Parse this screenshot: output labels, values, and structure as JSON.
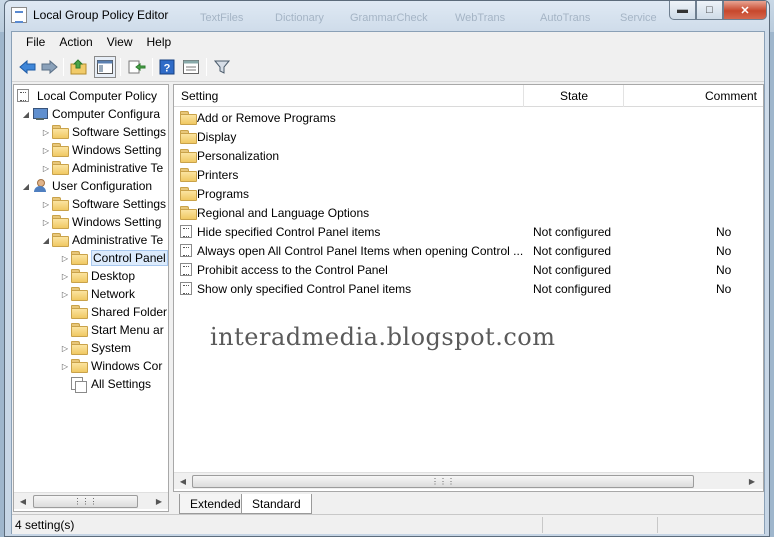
{
  "window": {
    "title": "Local Group Policy Editor",
    "background_taskbar_items": [
      "TextFiles",
      "Dictionary",
      "GrammarCheck",
      "WebTrans",
      "AutoTrans",
      "Service"
    ]
  },
  "menu": [
    "File",
    "Action",
    "View",
    "Help"
  ],
  "toolbar": {
    "icons": [
      "back-arrow-icon",
      "forward-arrow-icon",
      "up-folder-icon",
      "show-hide-console-tree-icon",
      "export-list-icon",
      "help-icon",
      "extended-view-icon",
      "filter-icon"
    ]
  },
  "tree": {
    "root": "Local Computer Policy",
    "computer_config": "Computer Configura",
    "cc_software": "Software Settings",
    "cc_windows": "Windows Setting",
    "cc_admin": "Administrative Te",
    "user_config": "User Configuration",
    "uc_software": "Software Settings",
    "uc_windows": "Windows Setting",
    "uc_admin": "Administrative Te",
    "control_panel": "Control Panel",
    "desktop": "Desktop",
    "network": "Network",
    "shared_folders": "Shared Folder",
    "start_menu": "Start Menu ar",
    "system": "System",
    "windows_comp": "Windows Cor",
    "all_settings": "All Settings"
  },
  "list": {
    "columns": {
      "setting": "Setting",
      "state": "State",
      "comment": "Comment"
    },
    "rows": [
      {
        "icon": "folder-icon",
        "setting": "Add or Remove Programs",
        "state": "",
        "comment": ""
      },
      {
        "icon": "folder-icon",
        "setting": "Display",
        "state": "",
        "comment": ""
      },
      {
        "icon": "folder-icon",
        "setting": "Personalization",
        "state": "",
        "comment": ""
      },
      {
        "icon": "folder-icon",
        "setting": "Printers",
        "state": "",
        "comment": ""
      },
      {
        "icon": "folder-icon",
        "setting": "Programs",
        "state": "",
        "comment": ""
      },
      {
        "icon": "folder-icon",
        "setting": "Regional and Language Options",
        "state": "",
        "comment": ""
      },
      {
        "icon": "policy-icon",
        "setting": "Hide specified Control Panel items",
        "state": "Not configured",
        "comment": "No"
      },
      {
        "icon": "policy-icon",
        "setting": "Always open All Control Panel Items when opening Control ...",
        "state": "Not configured",
        "comment": "No"
      },
      {
        "icon": "policy-icon",
        "setting": "Prohibit access to the Control Panel",
        "state": "Not configured",
        "comment": "No"
      },
      {
        "icon": "policy-icon",
        "setting": "Show only specified Control Panel items",
        "state": "Not configured",
        "comment": "No"
      }
    ]
  },
  "watermark": "interadmedia.blogspot.com",
  "tabs": [
    "Extended",
    "Standard"
  ],
  "status": "4 setting(s)"
}
